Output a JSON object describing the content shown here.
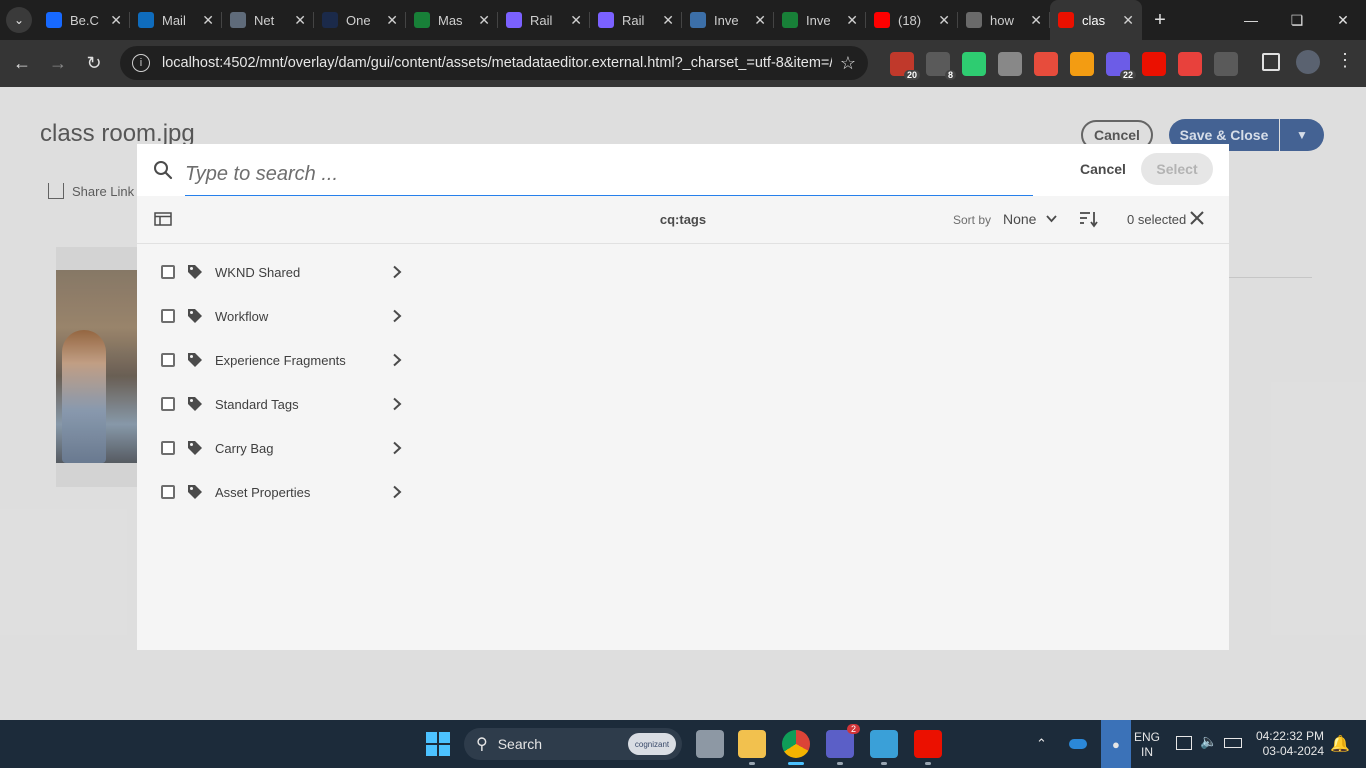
{
  "browser": {
    "tabs": [
      {
        "title": "Be.C",
        "favicon": "behance-icon",
        "color": "#1769ff"
      },
      {
        "title": "Mail",
        "favicon": "outlook-icon",
        "color": "#0f6cbd"
      },
      {
        "title": "Net",
        "favicon": "lock-icon",
        "color": "#5f6b7a"
      },
      {
        "title": "One",
        "favicon": "onenote-icon",
        "color": "#1b2a4a"
      },
      {
        "title": "Mas",
        "favicon": "sheets-icon",
        "color": "#188038"
      },
      {
        "title": "Rail",
        "favicon": "railway-icon",
        "color": "#7b61ff"
      },
      {
        "title": "Rail",
        "favicon": "railway-icon",
        "color": "#7b61ff"
      },
      {
        "title": "Inve",
        "favicon": "globe-icon",
        "color": "#3c6fa8"
      },
      {
        "title": "Inve",
        "favicon": "sheets-icon",
        "color": "#188038"
      },
      {
        "title": "(18)",
        "favicon": "youtube-icon",
        "color": "#ff0000"
      },
      {
        "title": "how",
        "favicon": "openai-icon",
        "color": "#6a6a6a"
      },
      {
        "title": "clas",
        "favicon": "adobe-icon",
        "color": "#eb1000",
        "active": true
      }
    ],
    "url": "localhost:4502/mnt/overlay/dam/gui/content/assets/metadataeditor.external.html?_charset_=utf-8&item=/...",
    "extensions": [
      {
        "name": "pdf-extension-icon",
        "color": "#c0392b",
        "badge": "20"
      },
      {
        "name": "clipboard-extension-icon",
        "color": "#5a5a5a",
        "badge": "8"
      },
      {
        "name": "diamond-extension-icon",
        "color": "#2ecc71",
        "badge": ""
      },
      {
        "name": "owl-extension-icon",
        "color": "#888888",
        "badge": ""
      },
      {
        "name": "eraser-extension-icon",
        "color": "#e74c3c",
        "badge": ""
      },
      {
        "name": "camera-extension-icon",
        "color": "#f39c12",
        "badge": ""
      },
      {
        "name": "purple-extension-icon",
        "color": "#6c5ce7",
        "badge": "22"
      },
      {
        "name": "adobe-extension-icon",
        "color": "#eb1000",
        "badge": ""
      },
      {
        "name": "red-extension-icon",
        "color": "#e8413c",
        "badge": ""
      },
      {
        "name": "puzzle-extension-icon",
        "color": "#5a5a5a",
        "badge": ""
      }
    ]
  },
  "page": {
    "title": "class room.jpg",
    "cancel_label": "Cancel",
    "save_close_label": "Save & Close",
    "share_link_label": "Share Link"
  },
  "dialog": {
    "search_placeholder": "Type to search ...",
    "search_value": "",
    "cancel_label": "Cancel",
    "select_label": "Select",
    "path_label": "cq:tags",
    "sort_by_label": "Sort by",
    "sort_value": "None",
    "selected_count": "0 selected",
    "tags": [
      {
        "label": "WKND Shared"
      },
      {
        "label": "Workflow"
      },
      {
        "label": "Experience Fragments"
      },
      {
        "label": "Standard Tags"
      },
      {
        "label": "Carry Bag"
      },
      {
        "label": "Asset Properties"
      }
    ]
  },
  "taskbar": {
    "search_label": "Search",
    "search_badge": "cognizant",
    "teams_badge": "2",
    "lang_line1": "ENG",
    "lang_line2": "IN",
    "time": "04:22:32 PM",
    "date": "03-04-2024"
  },
  "colors": {
    "accent": "#2680eb",
    "primary_button": "#47679a",
    "taskbar": "#1c2b3a"
  }
}
